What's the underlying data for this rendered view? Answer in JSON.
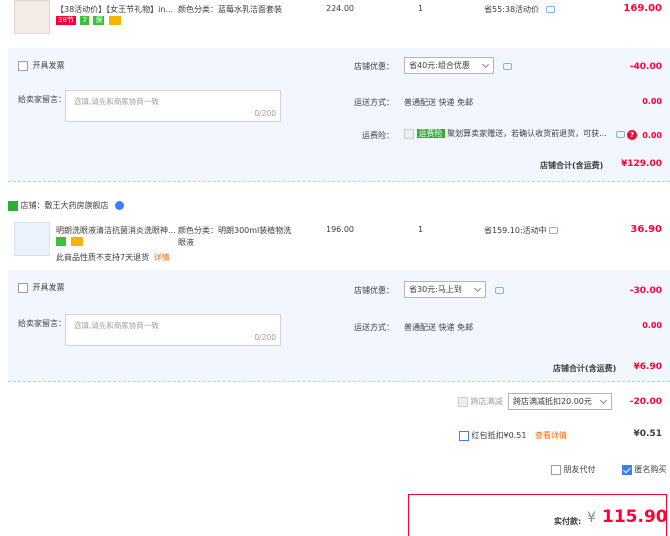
{
  "item1": {
    "title": "【38活动价】【女王节礼物】in...",
    "tags": [
      "38节",
      "7",
      "保"
    ],
    "spec": "颜色分类：蓝莓水乳洁面套装",
    "price": "224.00",
    "qty": "1",
    "discount": "省55:38活动价",
    "subtotal": "169.00"
  },
  "shop1": {
    "invoice_label": "开具发票",
    "promo_label": "店铺优惠：",
    "promo_value": "省40元:组合优惠",
    "promo_amount": "-40.00",
    "message_label": "给卖家留言：",
    "message_placeholder": "选填,请先和商家协商一致",
    "message_count": "0/200",
    "shipping_label": "运送方式：",
    "shipping_value": "普通配送 快递 免邮",
    "shipping_amount": "0.00",
    "insurance_label": "运费险：",
    "insurance_badge": "运费险",
    "insurance_text": "聚划算卖家赠送，若确认收货前退货，可获...",
    "insurance_amount": "0.00",
    "total_label": "店铺合计(含运费)",
    "total_value": "¥129.00"
  },
  "shop2": {
    "shop_name": "店铺：敷王大药房旗舰店",
    "item": {
      "title": "明朗洗眼液清洁抗菌消炎洗眼神...",
      "note": "此商品性质不支持7天退货",
      "note_link": "详情",
      "spec": "颜色分类：明朗300ml装植物洗眼液",
      "price": "196.00",
      "qty": "1",
      "discount": "省159.10:活动中",
      "subtotal": "36.90"
    },
    "invoice_label": "开具发票",
    "promo_label": "店铺优惠：",
    "promo_value": "省30元:马上到",
    "promo_amount": "-30.00",
    "message_label": "给卖家留言：",
    "message_placeholder": "选填,请先和商家协商一致",
    "message_count": "0/200",
    "shipping_label": "运送方式：",
    "shipping_value": "普通配送 快递 免邮",
    "shipping_amount": "0.00",
    "total_label": "店铺合计(含运费)",
    "total_value": "¥6.90"
  },
  "summary": {
    "cross_label": "跨店满减",
    "cross_select": "跨店满减抵扣20.00元",
    "cross_amount": "-20.00",
    "redpacket_label": "红包抵扣¥0.51",
    "redpacket_link": "查看详情",
    "redpacket_amount": "¥0.51",
    "friend_pay": "朋友代付",
    "anonymous": "匿名购买",
    "pay_label": "实付款:",
    "pay_symbol": "¥",
    "pay_amount": "115.90"
  },
  "colors": {
    "accent": "#ff0036",
    "panel": "#f2f7ff",
    "link": "#3c7ef5"
  }
}
